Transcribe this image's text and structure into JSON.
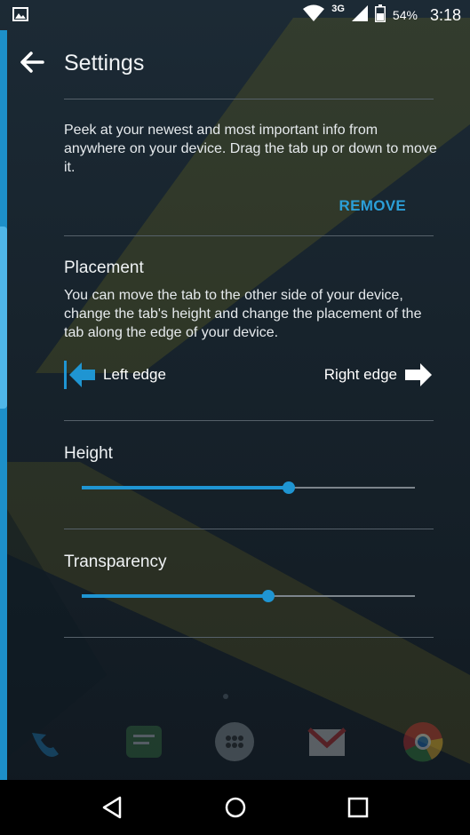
{
  "status_bar": {
    "network_type": "3G",
    "battery_percent": "54%",
    "time": "3:18",
    "icons": [
      "image-notification-icon",
      "wifi-icon",
      "signal-icon",
      "battery-icon"
    ]
  },
  "app_bar": {
    "title": "Settings",
    "back_icon": "arrow-left-icon"
  },
  "peek": {
    "description": "Peek at your newest and most important info from anywhere on your device. Drag the tab up or down to move it.",
    "remove_label": "REMOVE"
  },
  "placement": {
    "title": "Placement",
    "description": "You can move the tab to the other side of your device, change the tab's height and change the placement of the tab along the edge of your device.",
    "left_label": "Left edge",
    "right_label": "Right edge",
    "selected": "left"
  },
  "height": {
    "title": "Height",
    "value_fraction": 0.62
  },
  "transparency": {
    "title": "Transparency",
    "value_fraction": 0.56
  },
  "navigation": {
    "buttons": [
      "back-triangle-icon",
      "home-circle-icon",
      "recents-square-icon"
    ]
  },
  "colors": {
    "accent": "#1f95d2",
    "background": "#17232c",
    "text": "#e6eaed"
  }
}
